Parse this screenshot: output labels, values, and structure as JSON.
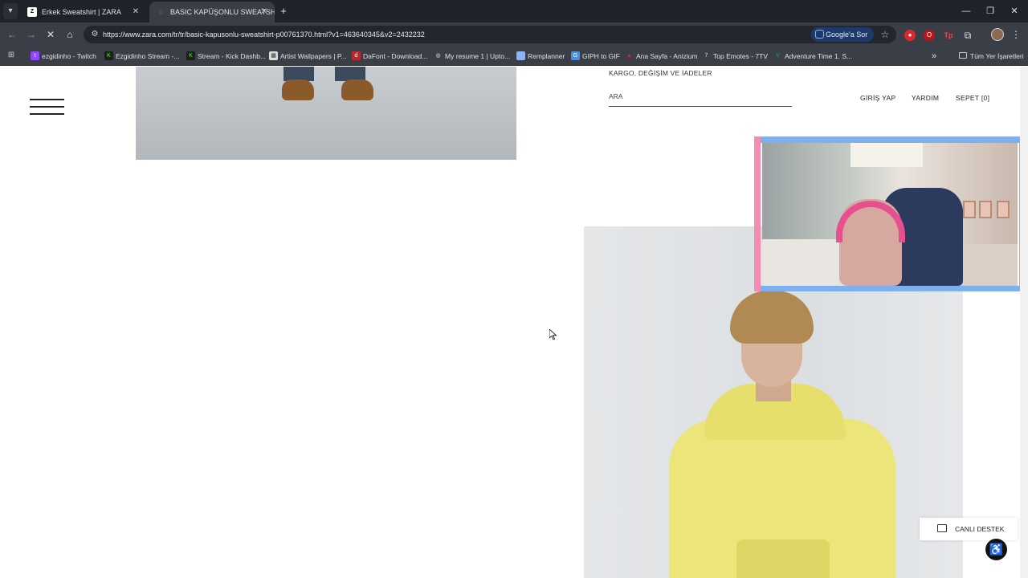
{
  "browser": {
    "tabs": [
      {
        "title": "Erkek Sweatshirt | ZARA",
        "favicon": "ZARA"
      },
      {
        "title": "BASIC KAPÜŞONLU SWEATSHIR",
        "favicon": "((·"
      }
    ],
    "url": "https://www.zara.com/tr/tr/basic-kapusonlu-sweatshirt-p00761370.html?v1=463640345&v2=2432232",
    "google_button": "Google'a Sor",
    "bookmarks": [
      {
        "label": "ezgidinho - Twitch",
        "icon": "twitch-icon",
        "color": "#9146ff"
      },
      {
        "label": "Ezgidinho Stream -...",
        "icon": "kick-icon",
        "color": "#53fc18"
      },
      {
        "label": "Stream - Kick Dashb...",
        "icon": "kick-icon",
        "color": "#53fc18"
      },
      {
        "label": "Artist Wallpapers | P...",
        "icon": "wallpaper-icon",
        "color": "#9aa0a6"
      },
      {
        "label": "DaFont - Download...",
        "icon": "dafont-icon",
        "color": "#c0262d"
      },
      {
        "label": "My resume 1 | Upto...",
        "icon": "globe-icon",
        "color": "#5f6368"
      },
      {
        "label": "Remplanner",
        "icon": "folder-icon",
        "color": "#8ab4f8"
      },
      {
        "label": "GIPH to GIF",
        "icon": "giphy-icon",
        "color": "#4a90e2"
      },
      {
        "label": "Ana Sayfa - Anizium",
        "icon": "anizium-icon",
        "color": "#e0252d"
      },
      {
        "label": "Top Emotes - 7TV",
        "icon": "7tv-icon",
        "color": "#dfe3e8"
      },
      {
        "label": "Adventure Time 1. S...",
        "icon": "adventure-icon",
        "color": "#2ea44f"
      }
    ],
    "all_bookmarks": "Tüm Yer İşaretleri"
  },
  "site": {
    "shipping": "KARGO, DEĞİŞİM VE İADELER",
    "search_placeholder": "ARA",
    "login": "GİRİŞ YAP",
    "help": "YARDIM",
    "cart": "SEPET [0]",
    "live_support": "CANLI DESTEK"
  }
}
